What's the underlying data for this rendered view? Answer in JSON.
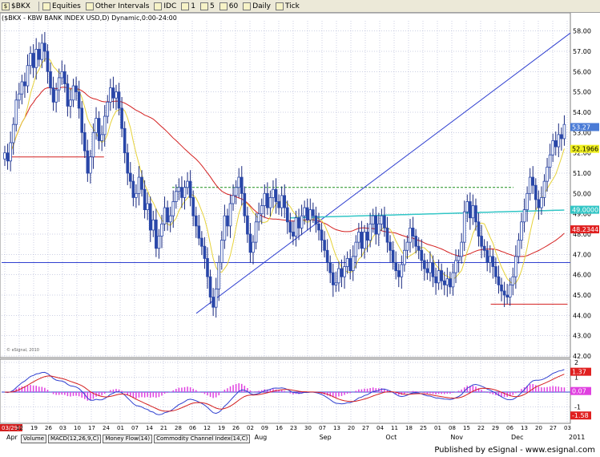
{
  "toolbar": {
    "symbol": "$BKX",
    "items": [
      "Equities",
      "Other Intervals",
      "IDC",
      "1",
      "5",
      "60",
      "Daily",
      "Tick"
    ]
  },
  "chart_title": "($BKX - KBW BANK INDEX USD,D) Dynamic,0:00-24:00",
  "watermark": "© eSignal, 2010",
  "footer": "Published by eSignal - www.esignal.com",
  "tabs": [
    "Volume",
    "MACD(12,26,9,C)",
    "Money Flow(14)",
    "Commodity Channel Index(14,C)"
  ],
  "colors": {
    "up": "#2946a8",
    "down": "#2946a8",
    "grid": "#9aa0c8",
    "ma_fast": "#e6d23a",
    "ma_slow": "#d42020",
    "cyan": "#33c6c6",
    "trend": "#3040d0",
    "dashed_green": "#1f8f1f"
  },
  "price_labels": [
    {
      "label": "53.27",
      "value": 53.27,
      "bg": "#4a7bd6",
      "fg": "#ffffff"
    },
    {
      "label": "52.1966",
      "value": 52.1966,
      "bg": "#f0f020",
      "fg": "#000000"
    },
    {
      "label": "49.0000",
      "value": 49.2,
      "bg": "#33c6c6",
      "fg": "#ffffff"
    },
    {
      "label": "48.2344",
      "value": 48.2344,
      "bg": "#e02020",
      "fg": "#ffffff"
    }
  ],
  "macd_labels": [
    {
      "label": "1.37",
      "value": 1.37,
      "bg": "#e02020",
      "fg": "#ffffff"
    },
    {
      "label": "0.07",
      "value": 0.07,
      "bg": "#e040e0",
      "fg": "#ffffff"
    },
    {
      "label": "-1.58",
      "value": -1.58,
      "bg": "#e02020",
      "fg": "#ffffff"
    }
  ],
  "chart_data": {
    "type": "candlestick",
    "title": "($BKX - KBW BANK INDEX USD,D) Dynamic,0:00-24:00",
    "yticks": [
      "58.00",
      "57.00",
      "56.00",
      "55.00",
      "54.00",
      "53.00",
      "52.00",
      "51.00",
      "50.00",
      "49.00",
      "48.00",
      "47.00",
      "46.00",
      "45.00",
      "44.00",
      "43.00",
      "42.00"
    ],
    "ylim": [
      42,
      58.5
    ],
    "date_labels": [
      "03/29/10",
      "12",
      "19",
      "26",
      "03",
      "10",
      "17",
      "24",
      "01",
      "07",
      "14",
      "21",
      "28",
      "06",
      "12",
      "19",
      "26",
      "02",
      "09",
      "16",
      "23",
      "30",
      "07",
      "13",
      "20",
      "27",
      "04",
      "11",
      "18",
      "25",
      "01",
      "08",
      "15",
      "22",
      "29",
      "06",
      "13",
      "20",
      "27",
      "03"
    ],
    "month_labels": [
      "Apr",
      "May",
      "Jun",
      "Jul",
      "Aug",
      "Sep",
      "Oct",
      "Nov",
      "Dec",
      "2011"
    ],
    "closes": [
      52.0,
      51.6,
      52.5,
      53.4,
      54.6,
      54.9,
      55.5,
      55.3,
      56.3,
      56.9,
      56.2,
      57.1,
      56.6,
      57.4,
      57.0,
      56.0,
      55.2,
      54.5,
      55.1,
      55.7,
      56.0,
      55.4,
      54.3,
      54.6,
      55.3,
      55.0,
      54.2,
      53.0,
      52.1,
      51.0,
      51.8,
      53.0,
      53.7,
      52.6,
      52.9,
      53.8,
      54.5,
      55.2,
      54.7,
      55.0,
      54.2,
      53.2,
      52.0,
      51.0,
      50.6,
      49.8,
      50.0,
      50.8,
      50.2,
      49.2,
      49.5,
      48.2,
      48.7,
      47.3,
      47.9,
      48.5,
      49.3,
      48.6,
      48.9,
      49.6,
      50.1,
      50.3,
      49.8,
      50.3,
      50.6,
      49.8,
      48.9,
      48.4,
      47.8,
      47.4,
      46.8,
      45.9,
      44.9,
      44.4,
      45.3,
      46.6,
      47.7,
      48.9,
      48.4,
      49.5,
      49.9,
      50.3,
      50.8,
      50.0,
      48.9,
      48.0,
      47.1,
      47.6,
      48.6,
      49.0,
      49.4,
      50.0,
      49.3,
      49.8,
      50.2,
      49.6,
      49.3,
      49.9,
      49.3,
      48.6,
      48.1,
      47.9,
      48.8,
      48.3,
      48.9,
      49.3,
      48.7,
      49.2,
      48.9,
      48.5,
      48.2,
      47.7,
      47.2,
      46.6,
      46.1,
      45.5,
      45.6,
      46.3,
      45.9,
      46.4,
      46.8,
      46.2,
      46.9,
      47.6,
      48.1,
      47.3,
      48.1,
      47.7,
      48.5,
      48.9,
      48.0,
      48.5,
      48.9,
      48.3,
      47.6,
      47.2,
      46.6,
      46.2,
      45.9,
      46.5,
      47.2,
      47.6,
      48.3,
      47.9,
      47.4,
      47.2,
      46.7,
      46.3,
      46.1,
      46.6,
      45.9,
      45.6,
      46.2,
      45.7,
      45.5,
      45.8,
      45.4,
      46.1,
      46.7,
      46.9,
      47.6,
      49.1,
      49.6,
      48.8,
      49.4,
      48.6,
      47.9,
      47.4,
      47.2,
      46.6,
      46.9,
      46.4,
      45.9,
      45.5,
      45.2,
      45.0,
      44.9,
      45.5,
      45.9,
      46.9,
      47.7,
      48.6,
      49.2,
      50.0,
      50.8,
      50.4,
      49.7,
      49.3,
      49.8,
      50.6,
      51.3,
      51.9,
      52.6,
      52.3,
      52.9,
      52.7,
      53.4
    ],
    "hlines": [
      {
        "value": 51.8,
        "color": "#d42020",
        "name": "red-level"
      },
      {
        "value": 50.3,
        "color": "#1f8f1f",
        "name": "green-dashed-level",
        "dashed": true
      },
      {
        "value": 46.6,
        "color": "#3040d0",
        "name": "blue-level"
      },
      {
        "value": 44.55,
        "color": "#d42020",
        "name": "red-low-level"
      }
    ],
    "macd_ylim": [
      -2,
      2
    ],
    "macd_ticks": [
      "2",
      "1",
      "0",
      "-1"
    ]
  }
}
